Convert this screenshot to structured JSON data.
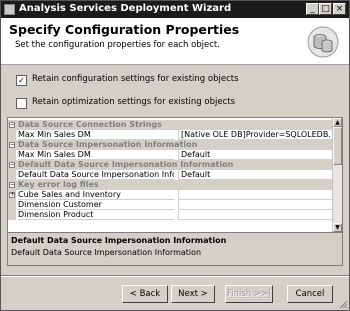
{
  "window": {
    "title": "Analysis Services Deployment Wizard",
    "controls": {
      "minimize": "_",
      "maximize": "□",
      "close": "×"
    }
  },
  "header": {
    "title": "Specify Configuration Properties",
    "subtitle": "Set the configuration properties for each object.",
    "icon": "database-icon"
  },
  "options": [
    {
      "label": "Retain configuration settings for existing objects",
      "checked": true,
      "mark": "✓"
    },
    {
      "label": "Retain optimization settings for existing objects",
      "checked": false,
      "mark": ""
    }
  ],
  "grid": {
    "categories": [
      {
        "label": "Data Source Connection Strings",
        "rows": [
          {
            "name": "Max Min Sales DM",
            "value": "[Native OLE DB]Provider=SQLOLEDB.1;Data Source"
          }
        ]
      },
      {
        "label": "Data Source Impersonation Information",
        "rows": [
          {
            "name": "Max Min Sales DM",
            "value": "Default"
          }
        ]
      },
      {
        "label": "Default Data Source Impersonation Information",
        "rows": [
          {
            "name": "Default Data Source Impersonation Information",
            "value": "Default"
          }
        ]
      },
      {
        "label": "Key error log files",
        "rows": [
          {
            "name": "Cube Sales and Inventory",
            "value": "",
            "expander": "+"
          },
          {
            "name": "Dimension Customer",
            "value": ""
          },
          {
            "name": "Dimension Product",
            "value": ""
          }
        ]
      }
    ],
    "expander_minus": "−"
  },
  "description": {
    "title": "Default Data Source Impersonation Information",
    "text": "Default Data Source Impersonation Information"
  },
  "buttons": {
    "back": "< Back",
    "next": "Next >",
    "finish": "Finish >>|",
    "cancel": "Cancel"
  }
}
